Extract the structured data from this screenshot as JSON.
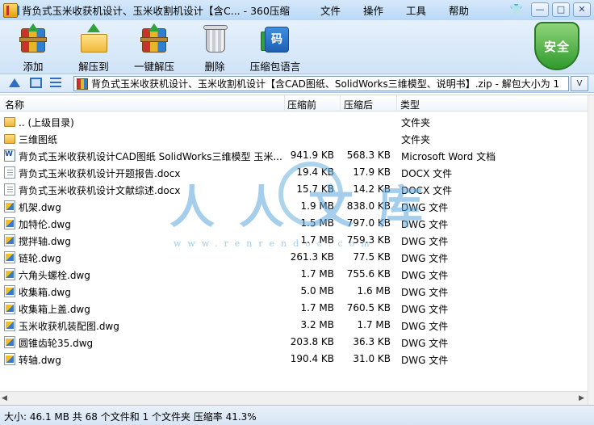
{
  "window": {
    "title": "背负式玉米收获机设计、玉米收割机设计【含C... - 360压缩",
    "menu": [
      "文件",
      "操作",
      "工具",
      "帮助"
    ],
    "controls": {
      "minimize": "—",
      "maximize": "□",
      "close": "✕"
    }
  },
  "toolbar": {
    "buttons": [
      {
        "label": "添加",
        "icon": "add-archive-icon"
      },
      {
        "label": "解压到",
        "icon": "extract-to-folder-icon"
      },
      {
        "label": "一键解压",
        "icon": "one-click-extract-icon"
      },
      {
        "label": "删除",
        "icon": "trash-icon"
      },
      {
        "label": "压缩包语言",
        "icon": "archive-language-icon"
      }
    ],
    "security_label": "安全"
  },
  "addressbar": {
    "path": "背负式玉米收获机设计、玉米收割机设计【含CAD图纸、SolidWorks三维模型、说明书】.zip - 解包大小为 1",
    "dropdown": "V"
  },
  "columns": {
    "name": "名称",
    "compressed": "压缩前",
    "uncompressed": "压缩后",
    "type": "类型"
  },
  "files": [
    {
      "name": ".. (上级目录)",
      "compressed": "",
      "uncompressed": "",
      "type": "文件夹",
      "kind": "folder"
    },
    {
      "name": "三维图纸",
      "compressed": "",
      "uncompressed": "",
      "type": "文件夹",
      "kind": "folder"
    },
    {
      "name": "背负式玉米收获机设计CAD图纸 SolidWorks三维模型 玉米...",
      "compressed": "941.9 KB",
      "uncompressed": "568.3 KB",
      "type": "Microsoft Word 文档",
      "kind": "word"
    },
    {
      "name": "背负式玉米收获机设计开题报告.docx",
      "compressed": "19.4 KB",
      "uncompressed": "17.9 KB",
      "type": "DOCX 文件",
      "kind": "docx"
    },
    {
      "name": "背负式玉米收获机设计文献综述.docx",
      "compressed": "15.7 KB",
      "uncompressed": "14.2 KB",
      "type": "DOCX 文件",
      "kind": "docx"
    },
    {
      "name": "机架.dwg",
      "compressed": "1.9 MB",
      "uncompressed": "838.0 KB",
      "type": "DWG 文件",
      "kind": "dwg"
    },
    {
      "name": "加特伦.dwg",
      "compressed": "1.5 MB",
      "uncompressed": "797.0 KB",
      "type": "DWG 文件",
      "kind": "dwg"
    },
    {
      "name": "搅拌轴.dwg",
      "compressed": "1.7 MB",
      "uncompressed": "759.3 KB",
      "type": "DWG 文件",
      "kind": "dwg"
    },
    {
      "name": "链轮.dwg",
      "compressed": "261.3 KB",
      "uncompressed": "77.5 KB",
      "type": "DWG 文件",
      "kind": "dwg"
    },
    {
      "name": "六角头螺栓.dwg",
      "compressed": "1.7 MB",
      "uncompressed": "755.6 KB",
      "type": "DWG 文件",
      "kind": "dwg"
    },
    {
      "name": "收集箱.dwg",
      "compressed": "5.0 MB",
      "uncompressed": "1.6 MB",
      "type": "DWG 文件",
      "kind": "dwg"
    },
    {
      "name": "收集箱上盖.dwg",
      "compressed": "1.7 MB",
      "uncompressed": "760.5 KB",
      "type": "DWG 文件",
      "kind": "dwg"
    },
    {
      "name": "玉米收获机装配图.dwg",
      "compressed": "3.2 MB",
      "uncompressed": "1.7 MB",
      "type": "DWG 文件",
      "kind": "dwg"
    },
    {
      "name": "圆锥齿轮35.dwg",
      "compressed": "203.8 KB",
      "uncompressed": "36.3 KB",
      "type": "DWG 文件",
      "kind": "dwg"
    },
    {
      "name": "转轴.dwg",
      "compressed": "190.4 KB",
      "uncompressed": "31.0 KB",
      "type": "DWG 文件",
      "kind": "dwg"
    }
  ],
  "status": "大小: 46.1 MB 共 68 个文件和 1 个文件夹 压缩率 41.3%",
  "watermark": {
    "big": "人人文库",
    "url": "www.renrendoc.com"
  },
  "colors": {
    "accent": "#2f6fc0",
    "security_green": "#2f9a2d",
    "titlebar": "#c8e0f7"
  }
}
